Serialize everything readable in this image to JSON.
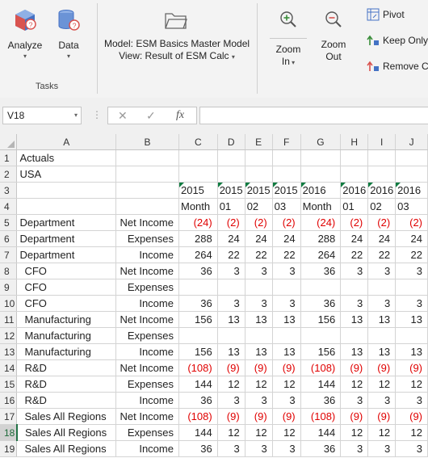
{
  "ribbon": {
    "analyze_label": "Analyze",
    "data_label": "Data",
    "group_tasks": "Tasks",
    "model_line": "Model: ESM Basics Master Model",
    "view_line": "View: Result of ESM Calc",
    "zoom_in_line1": "Zoom",
    "zoom_in_line2": "In",
    "zoom_out_line1": "Zoom",
    "zoom_out_line2": "Out",
    "pivot_label": "Pivot",
    "keep_only_label": "Keep Only",
    "remove_label": "Remove C"
  },
  "formula_bar": {
    "name_box": "V18",
    "fx_label": "fx",
    "formula": ""
  },
  "columns": [
    "A",
    "B",
    "C",
    "D",
    "E",
    "F",
    "G",
    "H",
    "I",
    "J"
  ],
  "rows": [
    {
      "n": "1",
      "cells": [
        "Actuals",
        "",
        "",
        "",
        "",
        "",
        "",
        "",
        "",
        ""
      ]
    },
    {
      "n": "2",
      "cells": [
        "USA",
        "",
        "",
        "",
        "",
        "",
        "",
        "",
        "",
        ""
      ]
    },
    {
      "n": "3",
      "cells": [
        "",
        "",
        "2015",
        "2015",
        "2015",
        "2015",
        "2016",
        "2016",
        "2016",
        "2016"
      ]
    },
    {
      "n": "4",
      "cells": [
        "",
        "",
        "Month",
        "01",
        "02",
        "03",
        "Month",
        "01",
        "02",
        "03"
      ]
    },
    {
      "n": "5",
      "cells": [
        "Department",
        "Net Income",
        "(24)",
        "(2)",
        "(2)",
        "(2)",
        "(24)",
        "(2)",
        "(2)",
        "(2)"
      ]
    },
    {
      "n": "6",
      "cells": [
        "Department",
        "Expenses",
        "288",
        "24",
        "24",
        "24",
        "288",
        "24",
        "24",
        "24"
      ]
    },
    {
      "n": "7",
      "cells": [
        "Department",
        "Income",
        "264",
        "22",
        "22",
        "22",
        "264",
        "22",
        "22",
        "22"
      ]
    },
    {
      "n": "8",
      "cells": [
        "CFO",
        "Net Income",
        "36",
        "3",
        "3",
        "3",
        "36",
        "3",
        "3",
        "3"
      ]
    },
    {
      "n": "9",
      "cells": [
        "CFO",
        "Expenses",
        "",
        "",
        "",
        "",
        "",
        "",
        "",
        ""
      ]
    },
    {
      "n": "10",
      "cells": [
        "CFO",
        "Income",
        "36",
        "3",
        "3",
        "3",
        "36",
        "3",
        "3",
        "3"
      ]
    },
    {
      "n": "11",
      "cells": [
        "Manufacturing",
        "Net Income",
        "156",
        "13",
        "13",
        "13",
        "156",
        "13",
        "13",
        "13"
      ]
    },
    {
      "n": "12",
      "cells": [
        "Manufacturing",
        "Expenses",
        "",
        "",
        "",
        "",
        "",
        "",
        "",
        ""
      ]
    },
    {
      "n": "13",
      "cells": [
        "Manufacturing",
        "Income",
        "156",
        "13",
        "13",
        "13",
        "156",
        "13",
        "13",
        "13"
      ]
    },
    {
      "n": "14",
      "cells": [
        "R&D",
        "Net Income",
        "(108)",
        "(9)",
        "(9)",
        "(9)",
        "(108)",
        "(9)",
        "(9)",
        "(9)"
      ]
    },
    {
      "n": "15",
      "cells": [
        "R&D",
        "Expenses",
        "144",
        "12",
        "12",
        "12",
        "144",
        "12",
        "12",
        "12"
      ]
    },
    {
      "n": "16",
      "cells": [
        "R&D",
        "Income",
        "36",
        "3",
        "3",
        "3",
        "36",
        "3",
        "3",
        "3"
      ]
    },
    {
      "n": "17",
      "cells": [
        "Sales All Regions",
        "Net Income",
        "(108)",
        "(9)",
        "(9)",
        "(9)",
        "(108)",
        "(9)",
        "(9)",
        "(9)"
      ]
    },
    {
      "n": "18",
      "cells": [
        "Sales All Regions",
        "Expenses",
        "144",
        "12",
        "12",
        "12",
        "144",
        "12",
        "12",
        "12"
      ]
    },
    {
      "n": "19",
      "cells": [
        "Sales All Regions",
        "Income",
        "36",
        "3",
        "3",
        "3",
        "36",
        "3",
        "3",
        "3"
      ]
    }
  ],
  "colors": {
    "negative": "#e00000",
    "selected_row_header": "#217346",
    "ribbon_bg": "#f3f3f3"
  }
}
